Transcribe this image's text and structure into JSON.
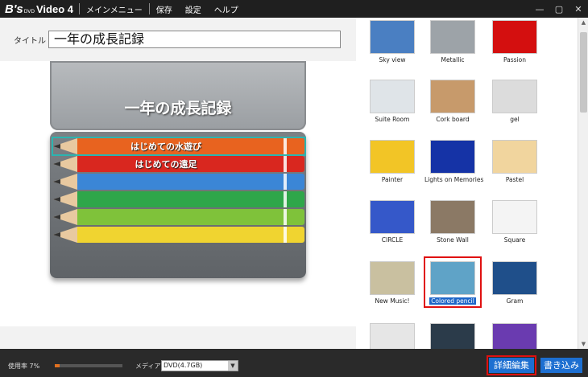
{
  "app": {
    "logo_mark": "B's",
    "logo_dvd": "DVD",
    "logo_video": "Video 4"
  },
  "menu": [
    "メインメニュー",
    "保存",
    "設定",
    "ヘルプ"
  ],
  "window_controls": [
    "—",
    "▢",
    "✕"
  ],
  "title_field": {
    "label": "タイトル",
    "value": "一年の成長記録"
  },
  "preview": {
    "heading": "一年の成長記録",
    "chapters": [
      "はじめての水遊び",
      "はじめての遠足"
    ],
    "pencil_colors": [
      "#e8631f",
      "#d9271f",
      "#3b86d6",
      "#2fa64a",
      "#7fc23a",
      "#f0d430"
    ]
  },
  "themes": [
    {
      "name": "Sky view",
      "color": "#4a7fc2"
    },
    {
      "name": "Metallic",
      "color": "#9da3a8"
    },
    {
      "name": "Passion",
      "color": "#d40f0f"
    },
    {
      "name": "Suite Room",
      "color": "#dfe4e8"
    },
    {
      "name": "Cork board",
      "color": "#c79a6b"
    },
    {
      "name": "gel",
      "color": "#dcdcdc"
    },
    {
      "name": "Painter",
      "color": "#f2c526"
    },
    {
      "name": "Lights on Memories",
      "color": "#1533a6"
    },
    {
      "name": "Pastel",
      "color": "#f1d59e"
    },
    {
      "name": "CIRCLE",
      "color": "#3558c9"
    },
    {
      "name": "Stone Wall",
      "color": "#8b7965"
    },
    {
      "name": "Square",
      "color": "#f4f4f4"
    },
    {
      "name": "New Music!",
      "color": "#c9c0a0"
    },
    {
      "name": "Colored pencil",
      "color": "#5fa3c7"
    },
    {
      "name": "Gram",
      "color": "#1f4f8a"
    },
    {
      "name": "",
      "color": "#e6e6e6"
    },
    {
      "name": "",
      "color": "#2b3b4a"
    },
    {
      "name": "",
      "color": "#6a3bb0"
    }
  ],
  "selected_theme": "Colored pencil",
  "status": {
    "usage_label": "使用率 7%",
    "usage_fraction": 0.07,
    "media_label": "メディア",
    "media_value": "DVD(4.7GB)"
  },
  "buttons": {
    "detail_edit": "詳細編集",
    "write": "書き込み"
  }
}
